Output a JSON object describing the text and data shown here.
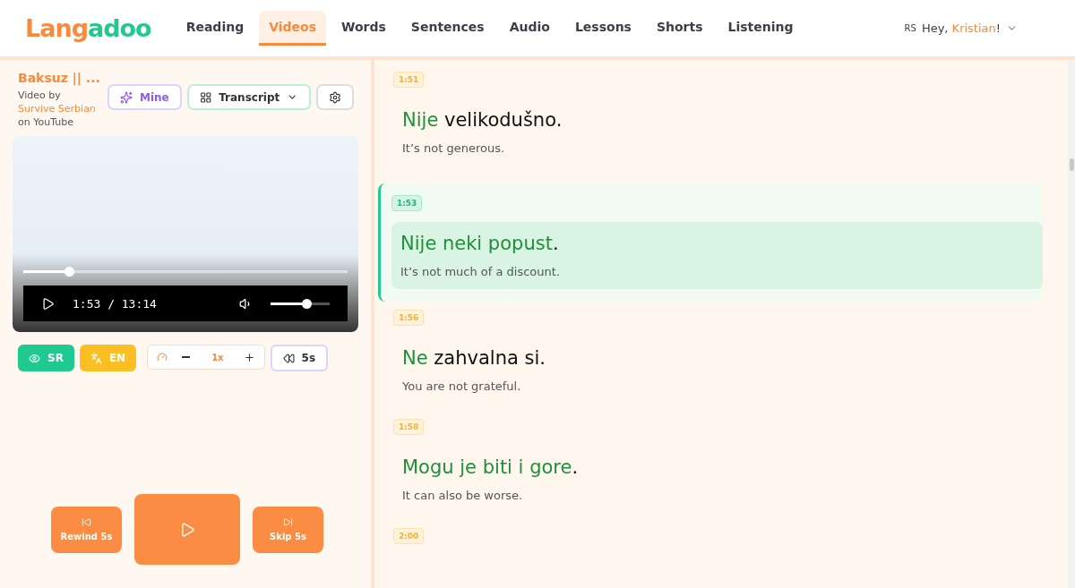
{
  "logo": [
    {
      "text": "Lang",
      "color": "#f98a3c"
    },
    {
      "text": "adoo",
      "color": "#1fc98f"
    }
  ],
  "nav": [
    {
      "label": "Reading",
      "selected": false
    },
    {
      "label": "Videos",
      "selected": true
    },
    {
      "label": "Words",
      "selected": false
    },
    {
      "label": "Sentences",
      "selected": false
    },
    {
      "label": "Audio",
      "selected": false
    },
    {
      "label": "Lessons",
      "selected": false
    },
    {
      "label": "Shorts",
      "selected": false
    },
    {
      "label": "Listening",
      "selected": false
    }
  ],
  "user": {
    "lang": "RS",
    "greeting": "Hey, ",
    "name": "Kristian",
    "suffix": "!"
  },
  "video": {
    "title": "Baksuz || ...",
    "by": "Video by ",
    "channel": "Survive Serbian",
    "on": " on YouTube",
    "mine": "Mine",
    "view": "Transcript",
    "time": "1:53 / 13:14",
    "progress": {
      "level": 0.14
    },
    "volume": {
      "level": 0.6
    }
  },
  "toggles": [
    {
      "label": "SR",
      "color": "#1fc98f"
    },
    {
      "label": "EN",
      "color": "#fbbf24"
    }
  ],
  "speed": "1x",
  "rewind_small": "5s",
  "transport": {
    "rewind": "Rewind 5s",
    "skip": "Skip 5s"
  },
  "lines": [
    {
      "time": "1:51",
      "selected": false,
      "parts": [
        {
          "text": "Nije",
          "known": true
        },
        {
          "text": " velikodušno.",
          "known": false
        }
      ],
      "translation": "It’s not generous."
    },
    {
      "time": "1:53",
      "selected": true,
      "parts": [
        {
          "text": "Nije neki popust",
          "known": true
        },
        {
          "text": ".",
          "known": false
        }
      ],
      "translation": "It’s not much of a discount."
    },
    {
      "time": "1:56",
      "selected": false,
      "parts": [
        {
          "text": "Ne",
          "known": true
        },
        {
          "text": " zahvalna si.",
          "known": false
        }
      ],
      "translation": "You are not grateful."
    },
    {
      "time": "1:58",
      "selected": false,
      "parts": [
        {
          "text": "Mogu je biti i gore",
          "known": true
        },
        {
          "text": ".",
          "known": false
        }
      ],
      "translation": "It can also be worse."
    },
    {
      "time": "2:00",
      "selected": false
    }
  ]
}
